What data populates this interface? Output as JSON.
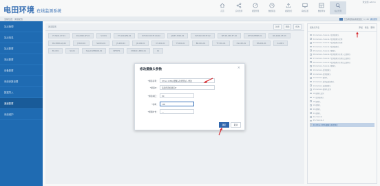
{
  "header": {
    "logo_main": "电田环境",
    "logo_sub": "在线监测系统",
    "user_link": "欢迎您 admin",
    "nav": [
      {
        "label": "首页",
        "icon": "home-icon"
      },
      {
        "label": "实时监测",
        "icon": "share-icon"
      },
      {
        "label": "报警管理",
        "icon": "dashboard-icon"
      },
      {
        "label": "数据报表",
        "icon": "clock-icon"
      },
      {
        "label": "视频监控",
        "icon": "upload-icon"
      },
      {
        "label": "系统设置",
        "icon": "monitor-icon"
      },
      {
        "label": "数据查询",
        "icon": "grid-icon"
      },
      {
        "label": "站点管理",
        "icon": "search-icon"
      }
    ]
  },
  "breadcrumb": "当前位置：通道配置",
  "sidebar": {
    "items": [
      "站点管理",
      "站点信息",
      "站点配置",
      "测点配置",
      "设备配置",
      "系统参数设置",
      "数据导入",
      "通道配置",
      "系统维护"
    ]
  },
  "main": {
    "title": "通道配置",
    "tools": [
      "新增",
      "删除",
      "修改"
    ],
    "tags": [
      "YF-S201-SF-01",
      "RS-2000-SF-02",
      "SY-001",
      "TH-101GEN-02",
      "WF-08-S3P-3F-09-02",
      "JN-BT-3300-02",
      "WF-08-S3P-3F-02",
      "WF-08-S3P-3F-02",
      "WF-08-TEMP-01",
      "RS-2000-SF-03",
      "RS-3000-AQ-01",
      "JT-100-01",
      "SK-001-01",
      "JS-200-01",
      "JS-100-01",
      "CY-201-01",
      "YT-001-01",
      "BZ-001-01",
      "TF-301-01",
      "CS-100-01",
      "BS-001-01",
      "A1-001",
      "B1-001",
      "S1-01",
      "Type0-SENSOR-01",
      "SPTOTS",
      "DWR-01-MDS-01",
      "01"
    ]
  },
  "right_panel": {
    "top_text": "已选择摄像头通道数量：1 / 28",
    "top_link": "通道管理",
    "title": "摄像头列表",
    "buttons": [
      "添加",
      "修改",
      "删除"
    ],
    "items": [
      "01-Camera-channel-1监测摄像头",
      "02-Camera-channel-2监测摄像头北侧",
      "03-Camera-channel-3监测摄像头南侧",
      "04-Camera-channel-4监测摄像头",
      "05-Camera-channel-5摄像头",
      "06-Camera-channel-6监测摄像头东侧入口摄像头",
      "07-Camera-channel-7监测摄像头西侧出口摄像头",
      "08-Camera-channel-8监测摄像头东侧出口摄像头",
      "09-Camera-channel-9摄像头",
      "10-Camera-监测摄像头",
      "11-Camera-监测摄像头",
      "12-Camera-摄像头",
      "13-Camera-监测设备摄像头",
      "14-Camera-设备摄像头",
      "15-Camera-摄像头监测",
      "16-摄像头监测",
      "17-监测摄像头",
      "18-摄像头",
      "19-摄像头",
      "20-摄像头",
      "21-摄像头",
      "22-channel",
      "23-channel-2",
      "24-Other-1080p摄像头新增测试"
    ],
    "selected_index": 23
  },
  "modal": {
    "title": "修改摄像头参数",
    "close": "×",
    "fields": [
      {
        "label": "*通道名称：",
        "value": "Other-1080p摄像头新增测试—修改"
      },
      {
        "label": "*通道IP：",
        "value": "请选择添加通道IP"
      },
      {
        "label": "*通道端口：",
        "value": "80"
      },
      {
        "label": "*帧率：",
        "value": "100"
      },
      {
        "label": "*视频时长：",
        "value": "---"
      }
    ],
    "ok_label": "确定",
    "cancel_label": "取消"
  },
  "colors": {
    "brand": "#3b73b9",
    "sidebar": "#1f6db7",
    "annotation_arrow": "#d6252a"
  }
}
